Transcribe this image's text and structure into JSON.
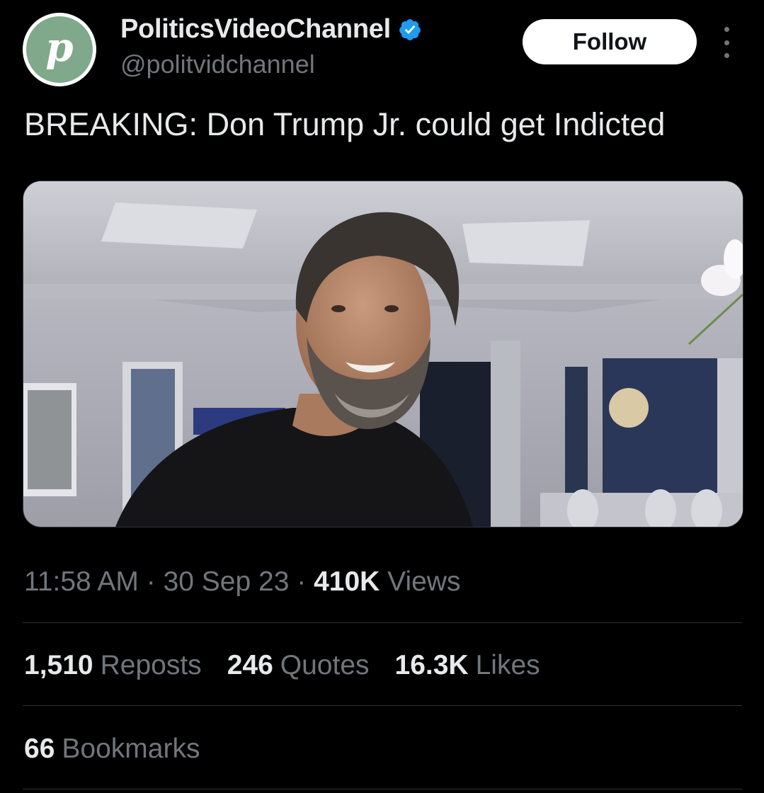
{
  "account": {
    "display_name": "PoliticsVideoChannel",
    "handle": "@politvidchannel",
    "avatar_letter": "p",
    "avatar_color": "#7fa98a",
    "verified": true,
    "verified_color": "#1d9bf0"
  },
  "actions": {
    "follow_label": "Follow",
    "more_icon": "more-vertical-icon"
  },
  "tweet": {
    "text": "BREAKING: Don Trump Jr. could get Indicted",
    "media_alt": "photo-of-smiling-bearded-man-in-black-tshirt-in-living-room"
  },
  "meta": {
    "time": "11:58 AM",
    "separator": " · ",
    "date": "30 Sep 23",
    "views_count": "410K",
    "views_label": "Views"
  },
  "stats": {
    "reposts_count": "1,510",
    "reposts_label": "Reposts",
    "quotes_count": "246",
    "quotes_label": "Quotes",
    "likes_count": "16.3K",
    "likes_label": "Likes"
  },
  "bookmarks": {
    "count": "66",
    "label": "Bookmarks"
  },
  "colors": {
    "background": "#000000",
    "primary_text": "#e7e9ea",
    "secondary_text": "#71767b",
    "divider": "#2f3336"
  }
}
